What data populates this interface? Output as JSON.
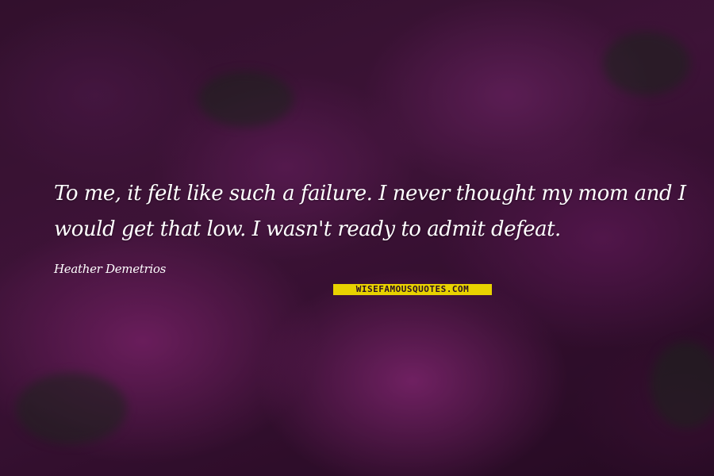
{
  "quote": {
    "line1": "To me, it felt like such a failure. I never thought my mom and I",
    "line2": "would get that low. I wasn't ready to admit defeat."
  },
  "author": "Heather Demetrios",
  "watermark": "WISEFAMOUSQUOTES.COM",
  "background": {
    "subject": "pink rhododendron flowers",
    "dominant_color": "#4a1842",
    "accent_color": "#e8d200"
  }
}
